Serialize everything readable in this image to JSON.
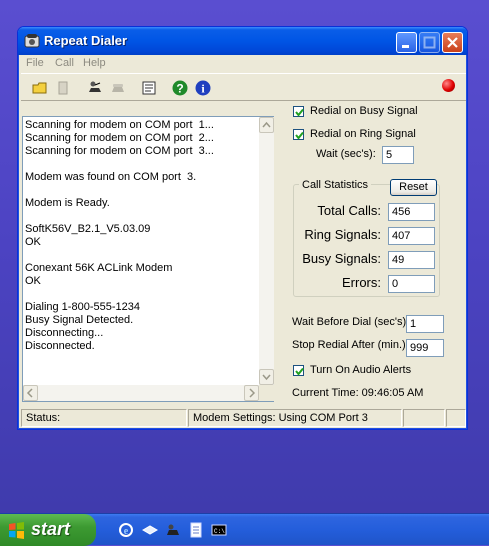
{
  "window": {
    "title": "Repeat Dialer"
  },
  "menu": {
    "items": [
      "File",
      "Call",
      "Help"
    ]
  },
  "toolbar": {
    "icons": [
      "open-log-icon",
      "clear-log-icon",
      "dial-icon",
      "hangup-icon",
      "settings-icon",
      "help-icon",
      "info-icon"
    ]
  },
  "log": {
    "lines": [
      "Scanning for modem on COM port  1...",
      "Scanning for modem on COM port  2...",
      "Scanning for modem on COM port  3...",
      "",
      "Modem was found on COM port  3.",
      "",
      "Modem is Ready.",
      "",
      "SoftK56V_B2.1_V5.03.09",
      "OK",
      "",
      "Conexant 56K ACLink Modem",
      "OK",
      "",
      "Dialing 1-800-555-1234",
      "Busy Signal Detected.",
      "Disconnecting...",
      "Disconnected."
    ]
  },
  "options": {
    "redial_busy": {
      "label": "Redial on Busy Signal",
      "checked": true
    },
    "redial_ring": {
      "label": "Redial on Ring Signal",
      "checked": true
    },
    "wait": {
      "label": "Wait (sec's):",
      "value": "5"
    }
  },
  "stats": {
    "title": "Call Statistics",
    "reset_label": "Reset",
    "total_calls": {
      "label": "Total Calls:",
      "value": "456"
    },
    "ring_signals": {
      "label": "Ring Signals:",
      "value": "407"
    },
    "busy_signals": {
      "label": "Busy Signals:",
      "value": "49"
    },
    "errors": {
      "label": "Errors:",
      "value": "0"
    }
  },
  "dial": {
    "wait_before": {
      "label": "Wait Before Dial (sec's):",
      "value": "1"
    },
    "stop_after": {
      "label": "Stop Redial After (min.):",
      "value": "999"
    },
    "audio": {
      "label": "Turn On Audio Alerts",
      "checked": true
    },
    "current_time": "Current Time: 09:46:05 AM"
  },
  "statusbar": {
    "status": "Status:",
    "modem": "Modem Settings: Using COM Port 3",
    "extra1": "",
    "extra2": ""
  },
  "taskbar": {
    "start_label": "start"
  }
}
